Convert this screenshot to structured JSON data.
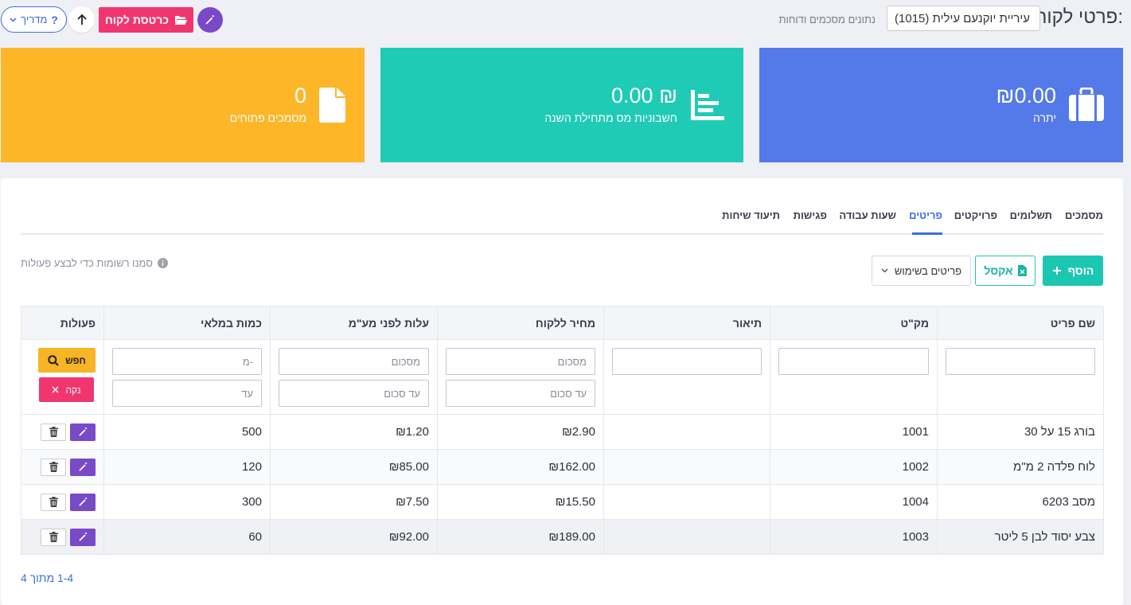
{
  "header": {
    "title": "פרטי לקוח:",
    "client_select": "עיריית יוקנעם עילית (1015)",
    "stats_label": "נתונים מסכמים ודוחות",
    "card_button": "כרטסת לקוח",
    "guide_button": "מדריך"
  },
  "stats": [
    {
      "value": "₪0.00",
      "label": "יתרה",
      "color": "#5479e8",
      "icon": "briefcase-icon"
    },
    {
      "value": "0.00 ₪",
      "label": "חשבוניות מס מתחילת השנה",
      "color": "#1fcbb5",
      "icon": "chart-icon"
    },
    {
      "value": "0",
      "label": "מסמכים פתוחים",
      "color": "#fdb628",
      "icon": "document-icon"
    }
  ],
  "tabs": [
    "מסמכים",
    "תשלומים",
    "פרויקטים",
    "פריטים",
    "שעות עבודה",
    "פגישות",
    "תיעוד שיחות"
  ],
  "active_tab": "פריטים",
  "toolbar": {
    "add": "הוסף",
    "excel": "אקסל",
    "items_select": "פריטים בשימוש",
    "hint": "סמנו רשומות כדי לבצע פעולות"
  },
  "table": {
    "headers": [
      "שם פריט",
      "מק\"ט",
      "תיאור",
      "מחיר ללקוח",
      "עלות לפני מע\"מ",
      "כמות במלאי",
      "פעולות"
    ],
    "filters": {
      "from_amount": "מסכום",
      "to_amount": "עד סכום",
      "from": "-מ",
      "to": "עד",
      "search": "חפש",
      "clear": "נקה"
    },
    "rows": [
      {
        "name": "בורג 15 על 30",
        "sku": "1001",
        "desc": "",
        "price": "₪2.90",
        "cost": "₪1.20",
        "qty": "500"
      },
      {
        "name": "לוח פלדה 2 מ\"מ",
        "sku": "1002",
        "desc": "",
        "price": "₪162.00",
        "cost": "₪85.00",
        "qty": "120"
      },
      {
        "name": "מסב 6203",
        "sku": "1004",
        "desc": "",
        "price": "₪15.50",
        "cost": "₪7.50",
        "qty": "300"
      },
      {
        "name": "צבע יסוד לבן 5 ליטר",
        "sku": "1003",
        "desc": "",
        "price": "₪189.00",
        "cost": "₪92.00",
        "qty": "60"
      }
    ]
  },
  "pagination": "1-4 מתוך 4"
}
